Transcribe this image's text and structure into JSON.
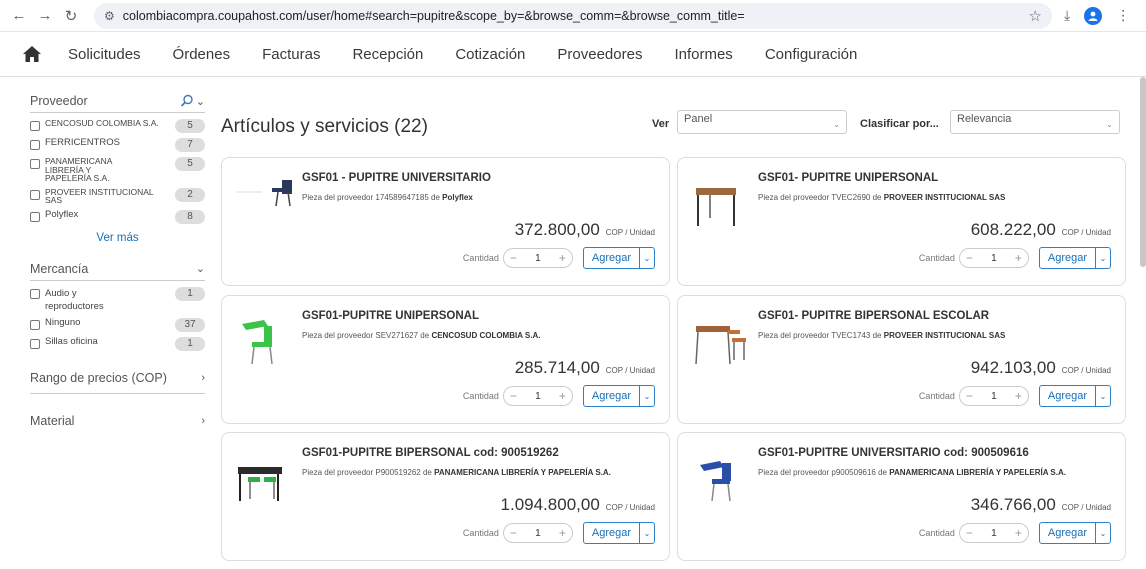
{
  "browser": {
    "url": "colombiacompra.coupahost.com/user/home#search=pupitre&scope_by=&browse_comm=&browse_comm_title="
  },
  "nav": {
    "items": [
      "Solicitudes",
      "Órdenes",
      "Facturas",
      "Recepción",
      "Cotización",
      "Proveedores",
      "Informes",
      "Configuración"
    ]
  },
  "sidebar": {
    "proveedor_title": "Proveedor",
    "proveedores": [
      {
        "label": "CENCOSUD COLOMBIA S.A.",
        "count": "5"
      },
      {
        "label": "FERRICENTROS",
        "count": "7"
      },
      {
        "label": "PANAMERICANA LIBRERÍA Y PAPELERÍA S.A.",
        "count": "5"
      },
      {
        "label": "PROVEER INSTITUCIONAL SAS",
        "count": "2"
      },
      {
        "label": "Polyflex",
        "count": "8"
      }
    ],
    "ver_mas": "Ver más",
    "mercancia_title": "Mercancía",
    "mercancias": [
      {
        "label": "Audio y reproductores",
        "count": "1"
      },
      {
        "label": "Ninguno",
        "count": "37"
      },
      {
        "label": "Sillas oficina",
        "count": "1"
      }
    ],
    "rango_title": "Rango de precios (COP)",
    "material_title": "Material"
  },
  "main": {
    "title": "Artículos y servicios (22)",
    "ver_label": "Ver",
    "ver_value": "Panel",
    "clasificar_label": "Clasificar por...",
    "clasificar_value": "Relevancia",
    "qty_label": "Cantidad",
    "add_label": "Agregar",
    "items": [
      {
        "name": "GSF01 - PUPITRE UNIVERSITARIO",
        "supplier_prefix": "Pieza del proveedor 174589647185 de",
        "supplier": "Polyflex",
        "price": "372.800,00",
        "unit": "COP / Unidad",
        "qty": "1"
      },
      {
        "name": "GSF01- PUPITRE UNIPERSONAL",
        "supplier_prefix": "Pieza del proveedor TVEC2690 de",
        "supplier": "PROVEER INSTITUCIONAL SAS",
        "price": "608.222,00",
        "unit": "COP / Unidad",
        "qty": "1"
      },
      {
        "name": "GSF01-PUPITRE UNIPERSONAL",
        "supplier_prefix": "Pieza del proveedor SEV271627 de",
        "supplier": "CENCOSUD COLOMBIA S.A.",
        "price": "285.714,00",
        "unit": "COP / Unidad",
        "qty": "1"
      },
      {
        "name": "GSF01- PUPITRE BIPERSONAL ESCOLAR",
        "supplier_prefix": "Pieza del proveedor TVEC1743 de",
        "supplier": "PROVEER INSTITUCIONAL SAS",
        "price": "942.103,00",
        "unit": "COP / Unidad",
        "qty": "1"
      },
      {
        "name": "GSF01-PUPITRE BIPERSONAL cod: 900519262",
        "supplier_prefix": "Pieza del proveedor P900519262 de",
        "supplier": "PANAMERICANA LIBRERÍA Y PAPELERÍA S.A.",
        "price": "1.094.800,00",
        "unit": "COP / Unidad",
        "qty": "1"
      },
      {
        "name": "GSF01-PUPITRE UNIVERSITARIO cod: 900509616",
        "supplier_prefix": "Pieza del proveedor p900509616 de",
        "supplier": "PANAMERICANA LIBRERÍA Y PAPELERÍA S.A.",
        "price": "346.766,00",
        "unit": "COP / Unidad",
        "qty": "1"
      }
    ]
  }
}
